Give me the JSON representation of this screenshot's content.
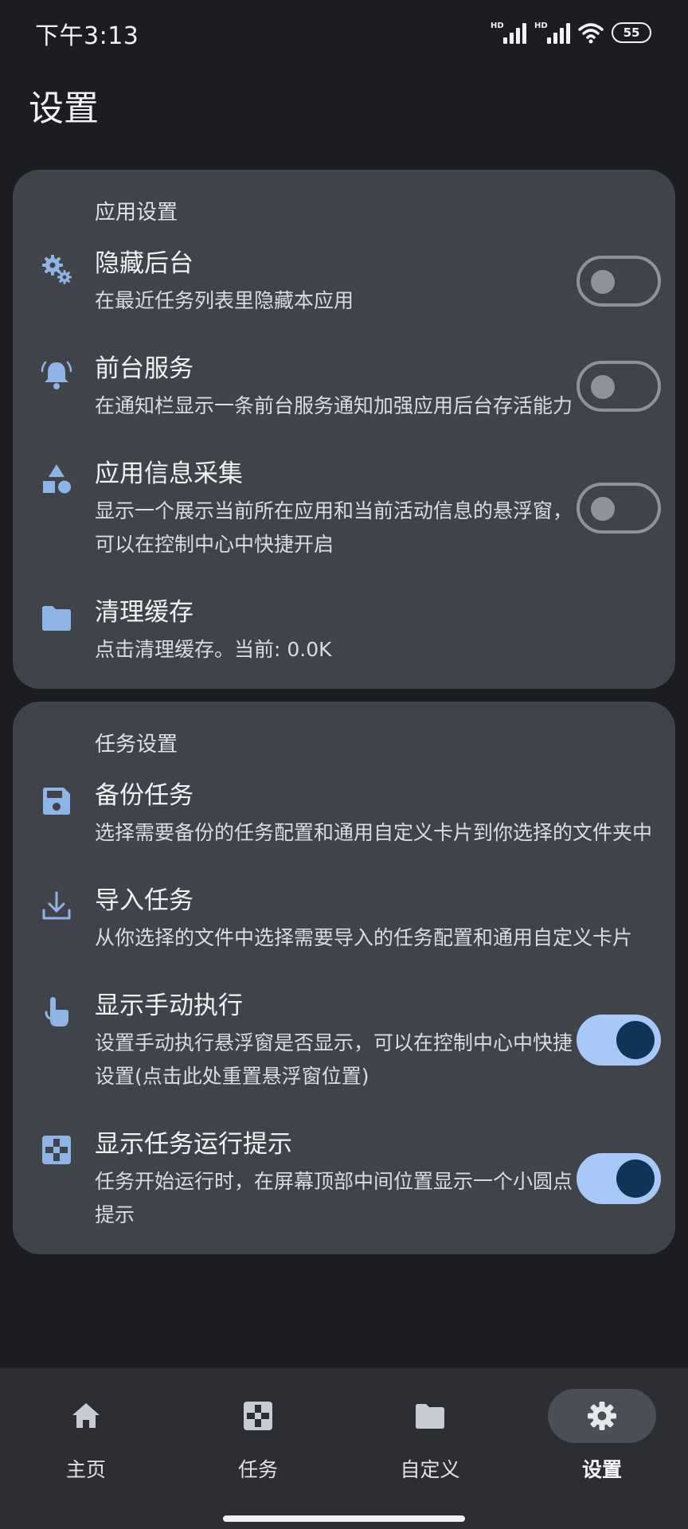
{
  "status_bar": {
    "time": "下午3:13",
    "hd1": "HD",
    "hd2": "HD",
    "battery": "55"
  },
  "page": {
    "title": "设置"
  },
  "sections": [
    {
      "title": "应用设置",
      "items": [
        {
          "title": "隐藏后台",
          "desc": "在最近任务列表里隐藏本应用",
          "icon": "gears-icon",
          "switch": "off"
        },
        {
          "title": "前台服务",
          "desc": "在通知栏显示一条前台服务通知加强应用后台存活能力",
          "icon": "bell-icon",
          "switch": "off"
        },
        {
          "title": "应用信息采集",
          "desc": "显示一个展示当前所在应用和当前活动信息的悬浮窗，可以在控制中心中快捷开启",
          "icon": "shapes-icon",
          "switch": "off"
        },
        {
          "title": "清理缓存",
          "desc": "点击清理缓存。当前: 0.0K",
          "icon": "folder-icon"
        }
      ]
    },
    {
      "title": "任务设置",
      "items": [
        {
          "title": "备份任务",
          "desc": "选择需要备份的任务配置和通用自定义卡片到你选择的文件夹中",
          "icon": "save-icon"
        },
        {
          "title": "导入任务",
          "desc": "从你选择的文件中选择需要导入的任务配置和通用自定义卡片",
          "icon": "download-icon"
        },
        {
          "title": "显示手动执行",
          "desc": "设置手动执行悬浮窗是否显示，可以在控制中心中快捷设置(点击此处重置悬浮窗位置)",
          "icon": "touch-icon",
          "switch": "on"
        },
        {
          "title": "显示任务运行提示",
          "desc": "任务开始运行时，在屏幕顶部中间位置显示一个小圆点提示",
          "icon": "crosshair-icon",
          "switch": "on"
        }
      ]
    }
  ],
  "nav": {
    "items": [
      {
        "label": "主页",
        "icon": "home-icon"
      },
      {
        "label": "任务",
        "icon": "tasks-icon"
      },
      {
        "label": "自定义",
        "icon": "folder-icon"
      },
      {
        "label": "设置",
        "icon": "settings-icon",
        "active": true
      }
    ]
  },
  "colors": {
    "background": "#1c1d20",
    "card": "#40434a",
    "accent": "#a8c8f8",
    "icon": "#8fb4e6"
  }
}
